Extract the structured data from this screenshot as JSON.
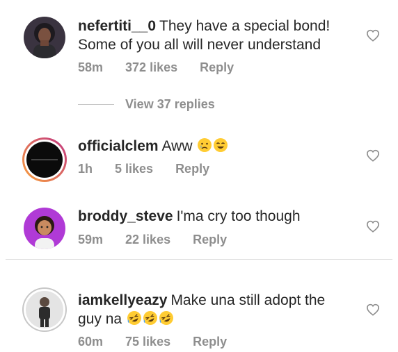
{
  "comments": [
    {
      "username": "nefertiti__0",
      "text": "They have a special bond! Some of you all will never understand",
      "time": "58m",
      "likes": "372 likes",
      "reply": "Reply",
      "view_replies": "View 37 replies"
    },
    {
      "username": "officialclem",
      "text": "Aww",
      "emojis": [
        "sad-tear-face",
        "smiling-face"
      ],
      "time": "1h",
      "likes": "5 likes",
      "reply": "Reply"
    },
    {
      "username": "broddy_steve",
      "text": "I'ma cry too though",
      "time": "59m",
      "likes": "22 likes",
      "reply": "Reply"
    },
    {
      "username": "iamkellyeazy",
      "text": "Make una still adopt the guy na",
      "emojis": [
        "rofl-face",
        "rofl-face",
        "rofl-face"
      ],
      "time": "60m",
      "likes": "75 likes",
      "reply": "Reply"
    }
  ],
  "icons": {
    "like": "heart-outline-icon"
  },
  "colors": {
    "text": "#262626",
    "meta": "#8e8e8e",
    "story_ring_start": "#f9a23b",
    "story_ring_end": "#c13584"
  }
}
